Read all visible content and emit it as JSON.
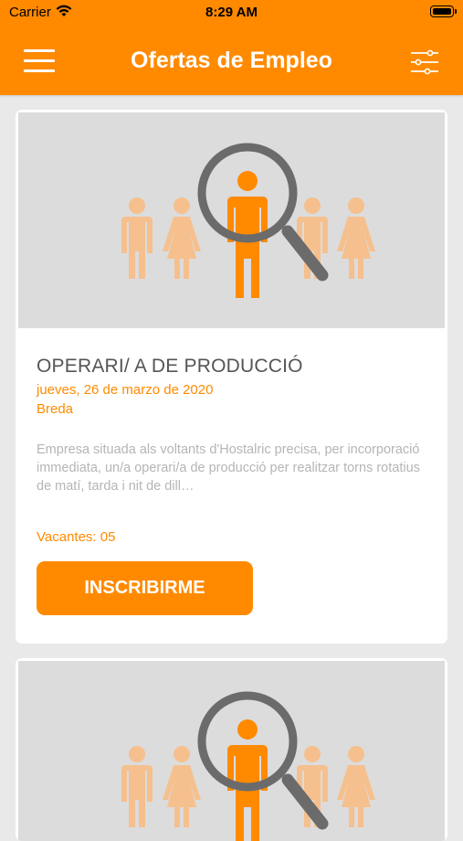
{
  "status_bar": {
    "carrier": "Carrier",
    "time": "8:29 AM"
  },
  "nav": {
    "title": "Ofertas de Empleo",
    "menu_icon": "hamburger-menu-icon",
    "filter_icon": "sliders-filter-icon"
  },
  "jobs": [
    {
      "title": "OPERARI/ A DE PRODUCCIÓ",
      "date": "jueves, 26 de marzo de 2020",
      "location": "Breda",
      "description": "Empresa situada als voltants d'Hostalric precisa, per incorporació immediata, un/a operari/a de producció per realitzar torns rotatius de matí, tarda i nit de dill…",
      "vacancies": "Vacantes: 05",
      "apply_label": "INSCRIBIRME"
    }
  ],
  "colors": {
    "accent": "#ff8a00",
    "people_light": "#f5c08e",
    "magnifier": "#6b6b6b",
    "hero_bg": "#dcdcdc"
  }
}
